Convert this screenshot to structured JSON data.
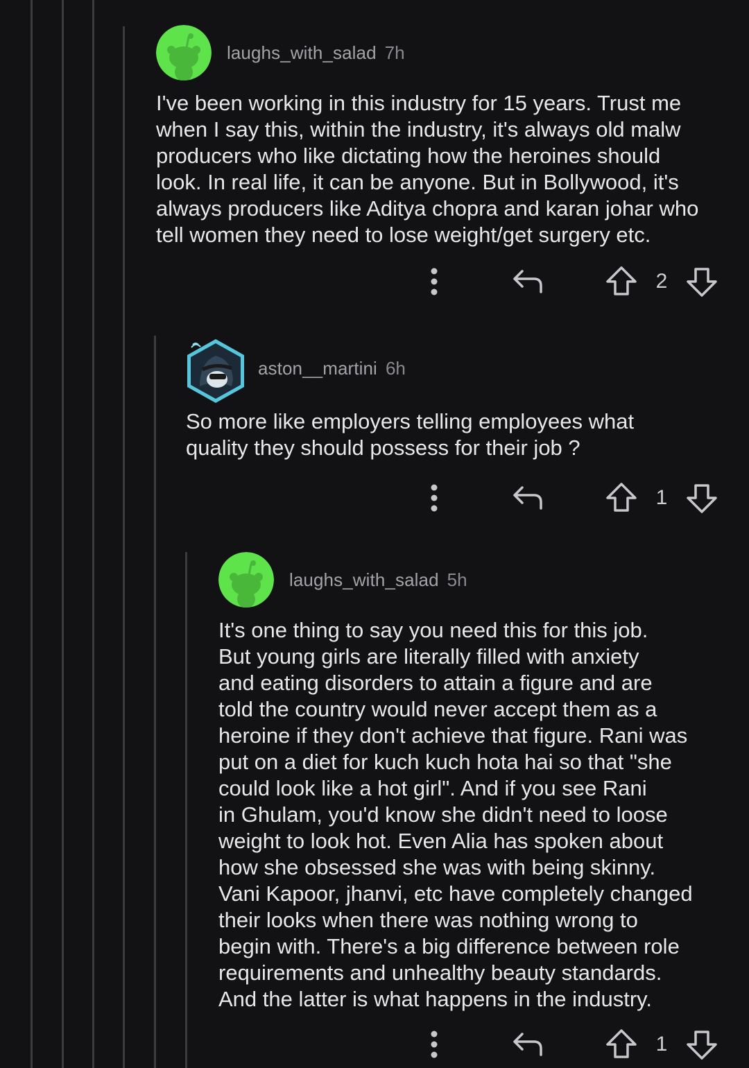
{
  "comments": [
    {
      "username": "laughs_with_salad",
      "age": "7h",
      "avatar": "snoo-avatar-green",
      "body": "I've been working in this industry for 15 years. Trust me\nwhen I say this, within the industry, it's always old malw\nproducers who like dictating how the heroines should\nlook. In real life, it can be anyone. But in Bollywood, it's\nalways producers like Aditya chopra and karan johar who\ntell women they need to lose weight/get surgery etc.",
      "score": "2"
    },
    {
      "username": "aston__martini",
      "age": "6h",
      "avatar": "hooded-character-avatar",
      "body": "So more like employers telling employees what\nquality they should possess for their job ?",
      "score": "1"
    },
    {
      "username": "laughs_with_salad",
      "age": "5h",
      "avatar": "snoo-avatar-green",
      "body": "It's one thing to say you need this for this job.\nBut young girls are literally filled with anxiety\nand eating disorders to attain a figure and are\ntold the country would never accept them as a\nheroine if they don't achieve that figure. Rani was\nput on a diet for kuch kuch hota hai so that \"she\ncould look like a hot girl\". And if you see Rani\nin Ghulam, you'd know she didn't need to loose\nweight to look hot. Even Alia has spoken about\nhow she obsessed she was with being skinny.\nVani Kapoor, jhanvi, etc have completely changed\ntheir looks when there was nothing wrong to\nbegin with. There's a big difference between role\nrequirements and unhealthy beauty standards.\nAnd the latter is what happens in the industry.",
      "score": "1"
    }
  ],
  "icons": {
    "more": "more-options-icon",
    "reply": "reply-arrow-icon",
    "upvote": "upvote-arrow-icon",
    "downvote": "downvote-arrow-icon"
  },
  "colors": {
    "background": "#121214",
    "thread_line": "#3c3c40",
    "snoo_green": "#5ee34a",
    "text": "#e8e8ea",
    "meta": "#a3a3a8"
  }
}
